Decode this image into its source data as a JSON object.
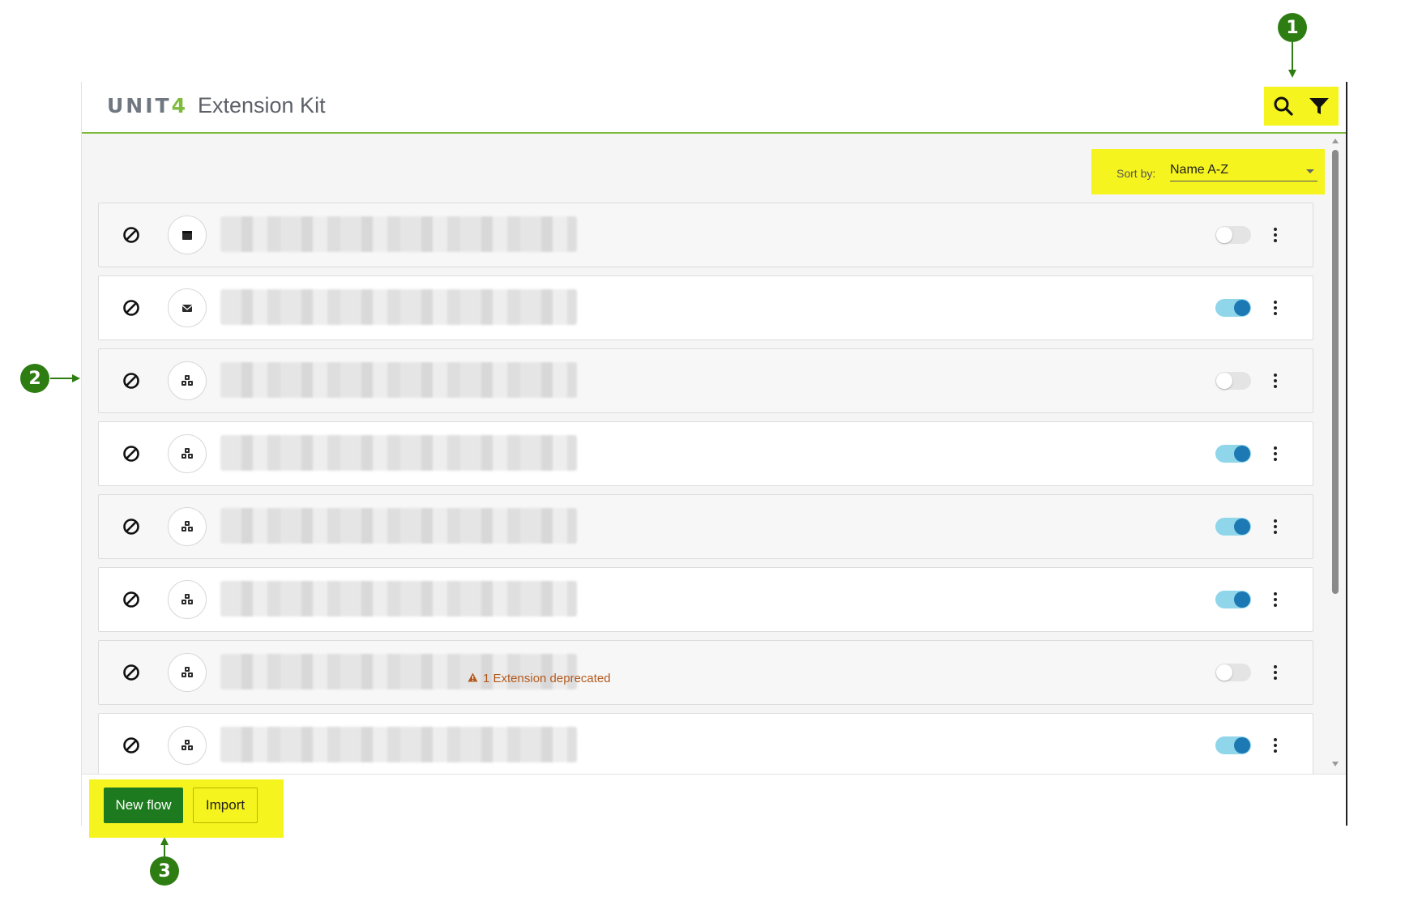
{
  "header": {
    "brand_left": "UNIT",
    "brand_right": "4",
    "product": "Extension Kit",
    "tools": [
      {
        "name": "search",
        "icon": "search-icon"
      },
      {
        "name": "filter",
        "icon": "filter-icon"
      }
    ]
  },
  "sort": {
    "label": "Sort by:",
    "value": "Name A-Z"
  },
  "rows": [
    {
      "type_icon": "calendar-icon",
      "enabled": false,
      "warning": ""
    },
    {
      "type_icon": "envelope-icon",
      "enabled": true,
      "warning": ""
    },
    {
      "type_icon": "cubes-icon",
      "enabled": false,
      "warning": ""
    },
    {
      "type_icon": "cubes-icon",
      "enabled": true,
      "warning": ""
    },
    {
      "type_icon": "cubes-icon",
      "enabled": true,
      "warning": ""
    },
    {
      "type_icon": "cubes-icon",
      "enabled": true,
      "warning": ""
    },
    {
      "type_icon": "cubes-icon",
      "enabled": false,
      "warning": "1 Extension deprecated"
    },
    {
      "type_icon": "cubes-icon",
      "enabled": true,
      "warning": ""
    }
  ],
  "footer": {
    "new_flow_label": "New flow",
    "import_label": "Import"
  },
  "annotations": {
    "c1": "1",
    "c2": "2",
    "c3": "3"
  },
  "colors": {
    "accent_green": "#7dbb3c",
    "highlight_yellow": "#f6f41e",
    "primary_button": "#1e7a1e",
    "toggle_on": "#1d79b3",
    "warning": "#b3591c",
    "callout": "#2e7d12"
  }
}
